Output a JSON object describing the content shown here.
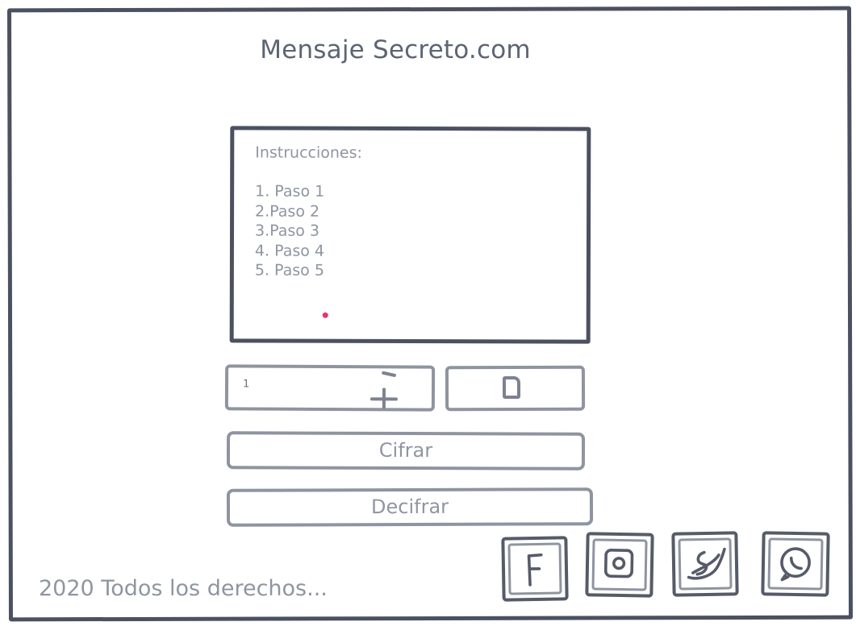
{
  "header": {
    "title": "Mensaje Secreto.com"
  },
  "instructions": {
    "heading": "Instrucciones:",
    "steps": [
      "1. Paso 1",
      "2.Paso 2",
      "3.Paso 3",
      "4. Paso 4",
      "5. Paso 5"
    ]
  },
  "stepper": {
    "value": "1",
    "minus_icon": "minus-icon",
    "plus_icon": "plus-icon"
  },
  "copy": {
    "icon": "copy-icon"
  },
  "buttons": {
    "encrypt_label": "Cifrar",
    "decrypt_label": "Decifrar"
  },
  "footer": {
    "text": "2020 Todos los derechos..."
  },
  "social": [
    {
      "icon": "facebook-icon"
    },
    {
      "icon": "instagram-icon"
    },
    {
      "icon": "twitter-icon"
    },
    {
      "icon": "whatsapp-icon"
    }
  ],
  "colors": {
    "border": "#4b5160",
    "muted_text": "#8f95a1",
    "cursor": "#e8356b"
  }
}
